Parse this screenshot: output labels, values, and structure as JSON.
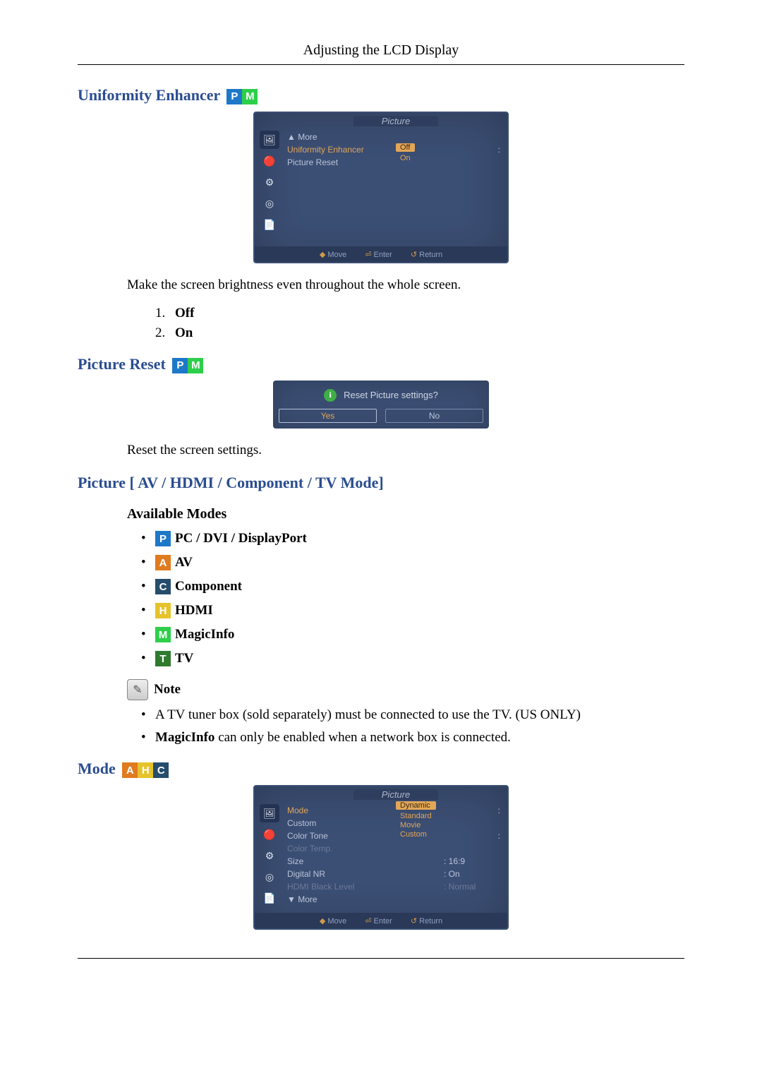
{
  "header": "Adjusting the LCD Display",
  "section_uniformity": {
    "title": "Uniformity Enhancer",
    "osd": {
      "title": "Picture",
      "more": "▲ More",
      "row_ue": "Uniformity Enhancer",
      "row_pr": "Picture Reset",
      "opt_off": "Off",
      "opt_on": "On",
      "foot_move": "Move",
      "foot_enter": "Enter",
      "foot_return": "Return"
    },
    "desc": "Make the screen brightness even throughout the whole screen.",
    "list": [
      "Off",
      "On"
    ]
  },
  "section_reset": {
    "title": "Picture Reset",
    "dialog": {
      "question": "Reset Picture settings?",
      "yes": "Yes",
      "no": "No"
    },
    "desc": "Reset the screen settings."
  },
  "section_picture_modes": {
    "title": "Picture [ AV / HDMI / Component / TV Mode]",
    "subtitle": "Available Modes",
    "modes": {
      "p": "PC / DVI / DisplayPort",
      "a": "AV",
      "c": "Component",
      "h": "HDMI",
      "m": "MagicInfo",
      "t": "TV"
    },
    "note_label": "Note",
    "notes": [
      "A TV tuner box (sold separately) must be connected to use the TV. (US ONLY)",
      "MagicInfo can only be enabled when a network box is connected."
    ],
    "note_bold_word": "MagicInfo"
  },
  "section_mode": {
    "title": "Mode",
    "osd": {
      "title": "Picture",
      "rows": {
        "mode": "Mode",
        "custom": "Custom",
        "color_tone": "Color Tone",
        "color_temp": "Color Temp.",
        "size": "Size",
        "digital_nr": "Digital NR",
        "hdmi_black": "HDMI Black Level"
      },
      "vals": {
        "size": "16:9",
        "digital_nr": "On",
        "hdmi_black": "Normal"
      },
      "opts": [
        "Dynamic",
        "Standard",
        "Movie",
        "Custom"
      ],
      "more": "▼ More",
      "foot_move": "Move",
      "foot_enter": "Enter",
      "foot_return": "Return"
    }
  }
}
